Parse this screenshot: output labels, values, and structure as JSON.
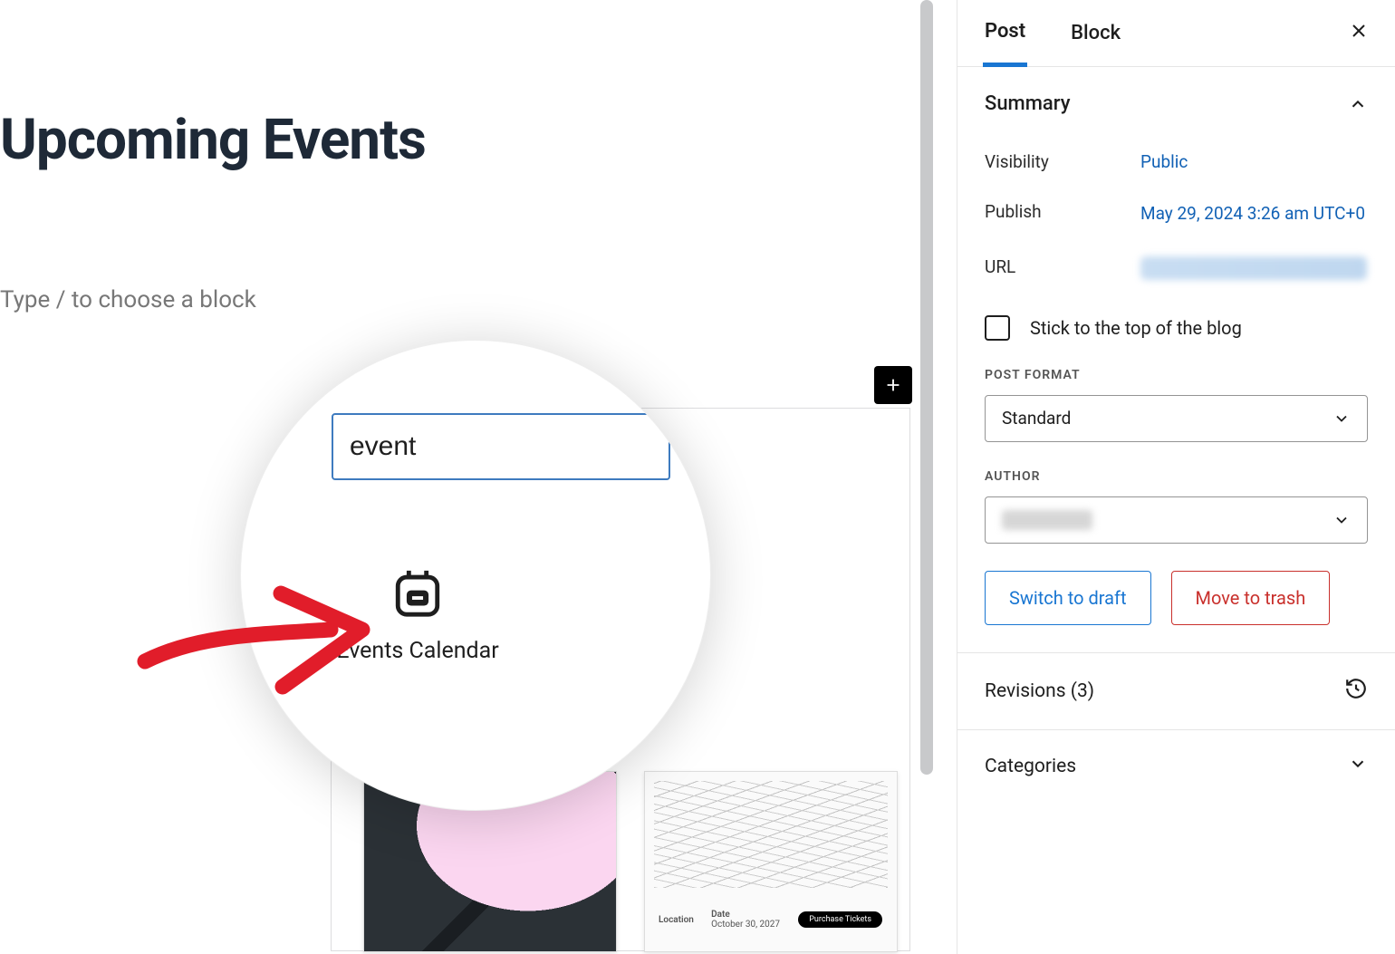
{
  "editor": {
    "post_title": "Upcoming Events",
    "block_prompt": "Type / to choose a block",
    "inserter": {
      "search_value": "event",
      "result_label": "Events Calendar"
    },
    "pattern_footer": {
      "loc_label": "Location",
      "date_label": "Date",
      "date_value": "October 30, 2027",
      "btn": "Purchase Tickets"
    }
  },
  "sidebar": {
    "tabs": {
      "post": "Post",
      "block": "Block"
    },
    "summary": {
      "heading": "Summary",
      "visibility_label": "Visibility",
      "visibility_value": "Public",
      "publish_label": "Publish",
      "publish_value": "May 29, 2024 3:26 am UTC+0",
      "url_label": "URL",
      "stick_label": "Stick to the top of the blog",
      "post_format_heading": "POST FORMAT",
      "post_format_value": "Standard",
      "author_heading": "AUTHOR",
      "switch_draft": "Switch to draft",
      "move_trash": "Move to trash"
    },
    "revisions": "Revisions (3)",
    "categories": "Categories"
  }
}
